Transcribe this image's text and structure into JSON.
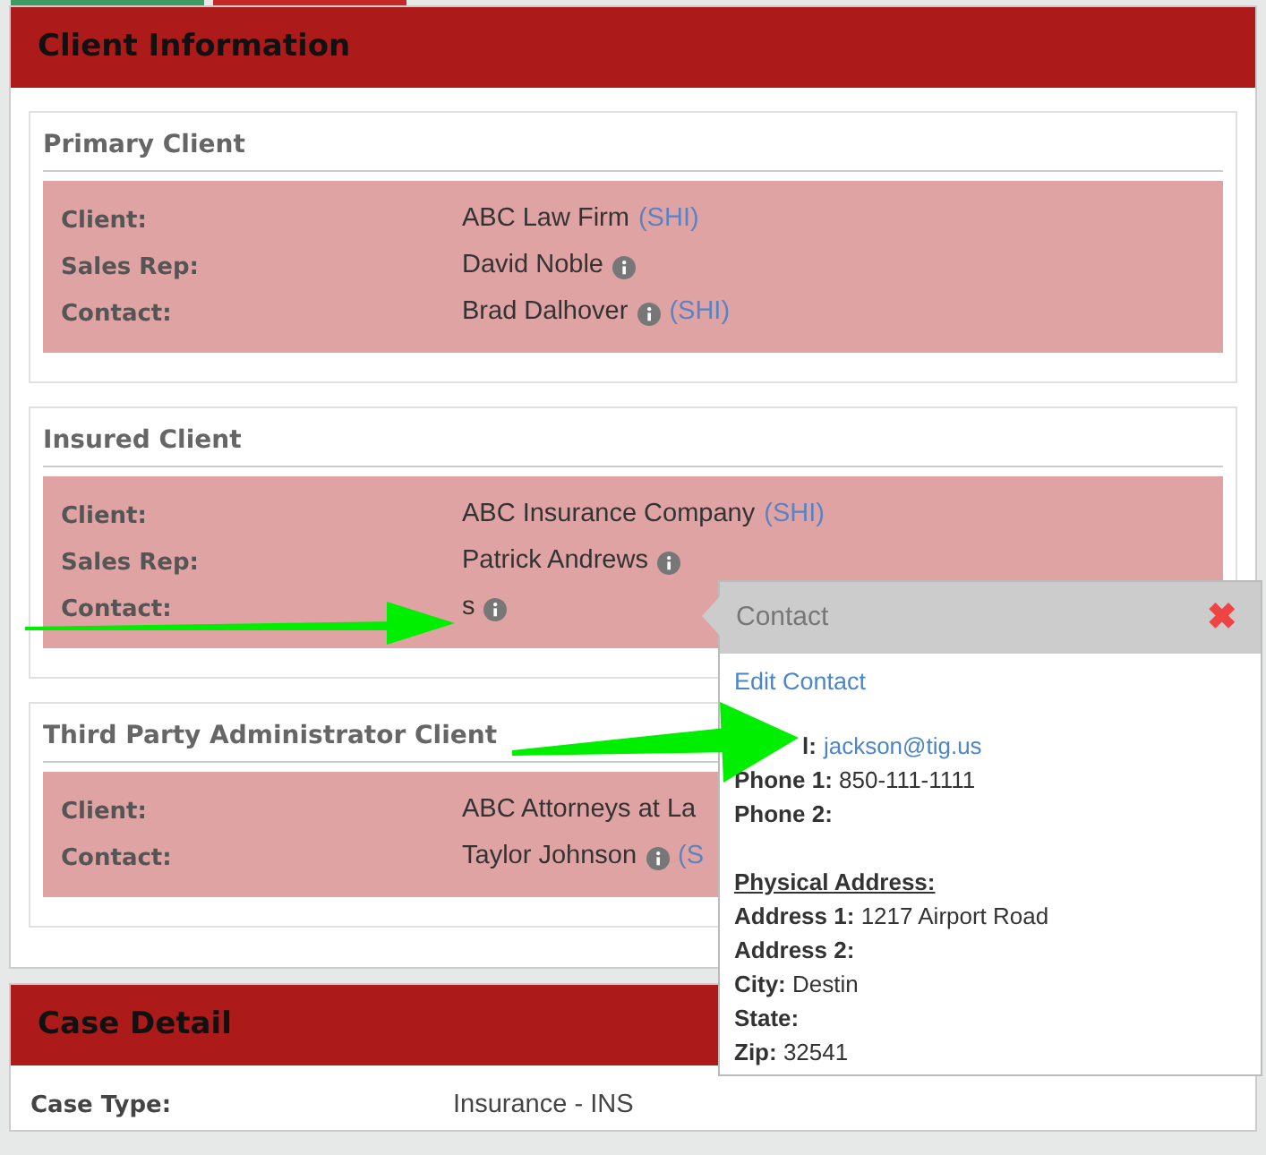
{
  "tabs": [
    {
      "color": "#3f9a63"
    },
    {
      "color": "#c62828"
    }
  ],
  "client_panel": {
    "title": "Client Information",
    "groups": [
      {
        "title": "Primary Client",
        "rows": [
          {
            "label": "Client:",
            "value": "ABC Law Firm",
            "info": false,
            "code": "(SHI)"
          },
          {
            "label": "Sales Rep:",
            "value": "David Noble",
            "info": true
          },
          {
            "label": "Contact:",
            "value": "Brad Dalhover",
            "info": true,
            "code": "(SHI)"
          }
        ]
      },
      {
        "title": "Insured Client",
        "rows": [
          {
            "label": "Client:",
            "value": "ABC Insurance Company",
            "info": false,
            "code": "(SHI)"
          },
          {
            "label": "Sales Rep:",
            "value": "Patrick Andrews",
            "info": true
          },
          {
            "label": "Contact:",
            "value": "s",
            "info": true
          }
        ]
      },
      {
        "title": "Third Party Administrator Client",
        "rows": [
          {
            "label": "Client:",
            "value": "ABC Attorneys at La",
            "info": false
          },
          {
            "label": "Contact:",
            "value": "Taylor Johnson",
            "info": true,
            "code": "(S"
          }
        ]
      }
    ]
  },
  "case_panel": {
    "title": "Case Detail",
    "rows": [
      {
        "label": "Case Type:",
        "value": "Insurance - INS"
      }
    ]
  },
  "popover": {
    "title": "Contact",
    "close": "✖",
    "edit_link": "Edit Contact",
    "fields": [
      {
        "label": "l:",
        "value": "jackson@tig.us",
        "kind": "link"
      },
      {
        "label": "Phone 1:",
        "value": "850-111-1111",
        "kind": "text"
      },
      {
        "label": "Phone 2:",
        "kind": "text"
      }
    ],
    "address_heading": "Physical Address:",
    "address_fields": [
      {
        "label": "Address 1:",
        "value": "1217 Airport Road"
      },
      {
        "label": "Address 2:"
      },
      {
        "label": "City:",
        "value": "Destin"
      },
      {
        "label": "State:"
      },
      {
        "label": "Zip:",
        "value": "32541"
      }
    ]
  }
}
